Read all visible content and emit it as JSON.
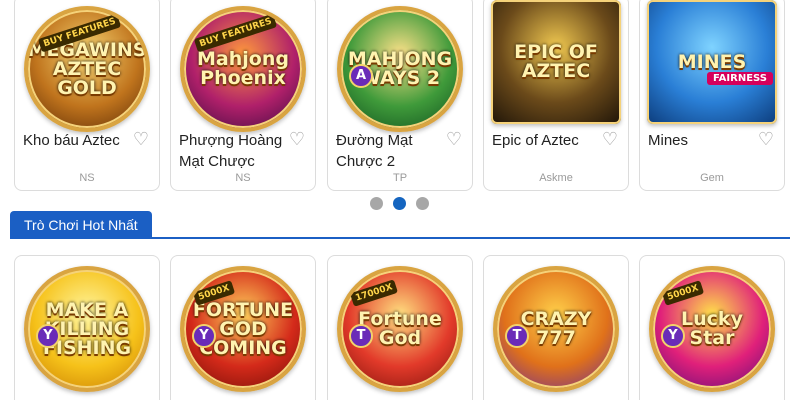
{
  "carousel": {
    "games": [
      {
        "name": "Kho báu Aztec",
        "provider": "NS",
        "thumb_text": "MEGAWINS AZTEC GOLD",
        "badge": "BUY FEATURES",
        "colors": [
          "#f7d774",
          "#c0741d",
          "#5a2a05"
        ]
      },
      {
        "name": "Phượng Hoàng Mạt Chược",
        "provider": "NS",
        "thumb_text": "Mahjong Phoenix",
        "badge": "BUY FEATURES",
        "colors": [
          "#ff9a3c",
          "#b0206a",
          "#3a0a40"
        ]
      },
      {
        "name": "Đường Mạt Chược 2",
        "provider": "TP",
        "thumb_text": "MAHJONG WAYS 2",
        "letter": "A",
        "colors": [
          "#ffe28a",
          "#3f9a3a",
          "#0f4d1e"
        ]
      },
      {
        "name": "Epic of Aztec",
        "provider": "Askme",
        "thumb_text": "EPIC OF AZTEC",
        "colors": [
          "#f0c850",
          "#6b4a1a",
          "#1e1408"
        ],
        "square": true
      },
      {
        "name": "Mines",
        "provider": "Gem",
        "thumb_text": "MINES",
        "ribbon": "FAIRNESS",
        "colors": [
          "#7fd3ff",
          "#2a7fd6",
          "#0c3b7a"
        ],
        "square": true
      }
    ],
    "pages": 3,
    "active_page": 1
  },
  "hot_section": {
    "title": "Trò Chơi Hot Nhất",
    "games": [
      {
        "thumb_text": "MAKE A KILLING FISHING",
        "letter": "Y",
        "colors": [
          "#fff6a0",
          "#f6c21a",
          "#c77a00"
        ]
      },
      {
        "thumb_text": "FORTUNE GOD COMING",
        "badge": "5000X",
        "letter": "Y",
        "colors": [
          "#ffcf5a",
          "#d42a1a",
          "#6e0c06"
        ]
      },
      {
        "thumb_text": "Fortune God",
        "badge": "17000X",
        "letter": "T",
        "colors": [
          "#ffe080",
          "#e23a2a",
          "#7a100a"
        ]
      },
      {
        "thumb_text": "CRAZY 777",
        "letter": "T",
        "colors": [
          "#ffd04a",
          "#e0711a",
          "#6a2a9a"
        ]
      },
      {
        "thumb_text": "Lucky Star",
        "badge": "5000X",
        "letter": "Y",
        "colors": [
          "#ffe14a",
          "#e0207a",
          "#5a0c7a"
        ]
      }
    ]
  }
}
